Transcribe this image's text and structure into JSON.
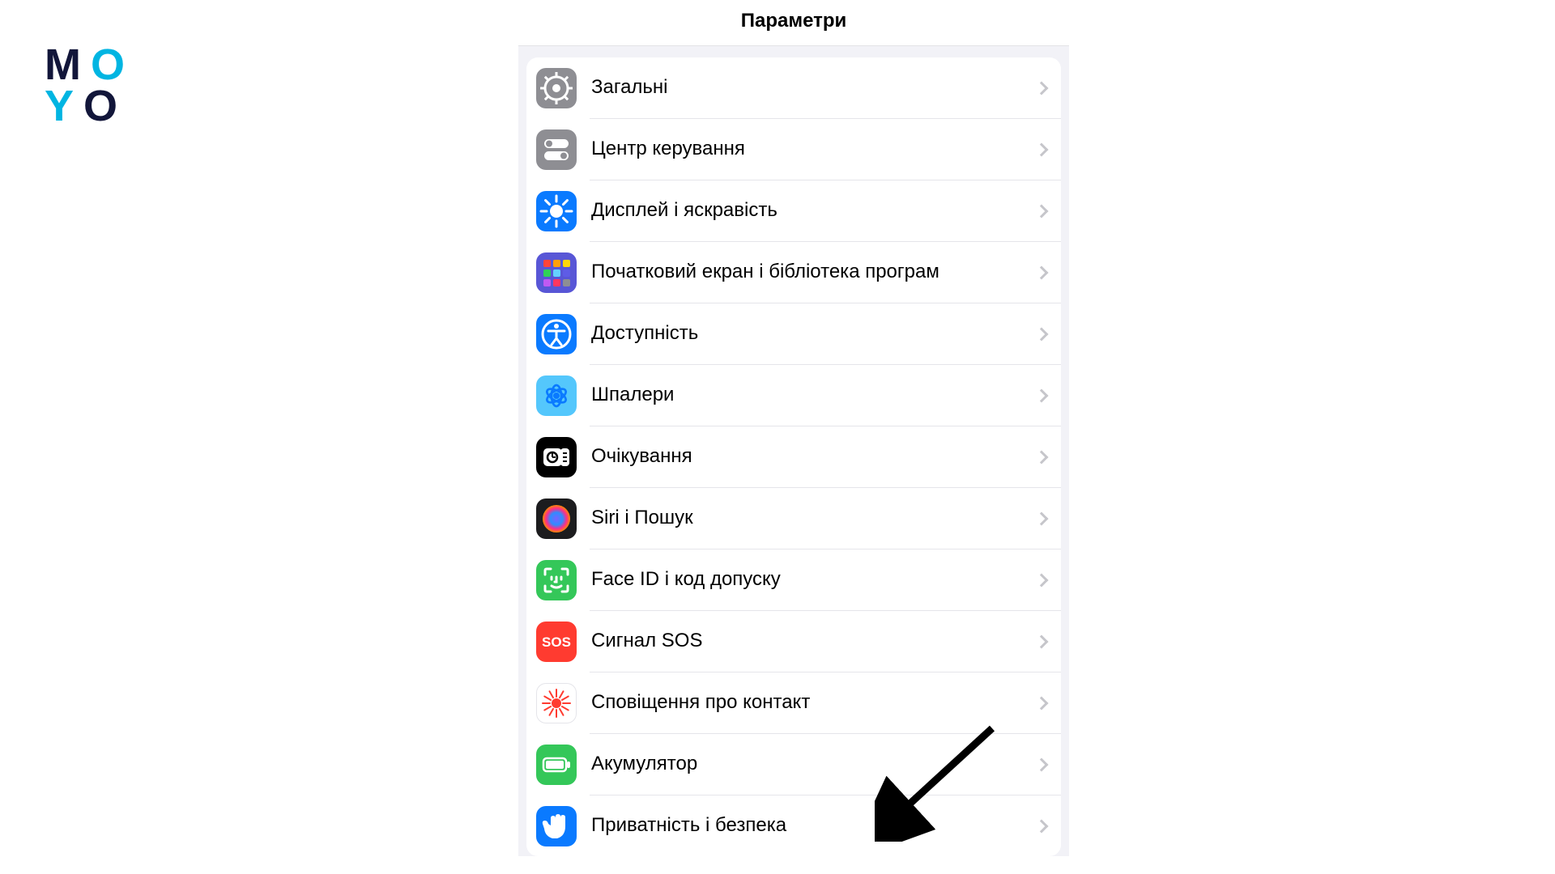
{
  "logo": {
    "l1a": "M",
    "l1b": "O",
    "l2a": "Y",
    "l2b": "O"
  },
  "header": {
    "title": "Параметри"
  },
  "items": [
    {
      "key": "general",
      "label": "Загальні",
      "bg": "#8e8e93",
      "icon": "gear"
    },
    {
      "key": "control",
      "label": "Центр керування",
      "bg": "#8e8e93",
      "icon": "toggles"
    },
    {
      "key": "display",
      "label": "Дисплей і яскравість",
      "bg": "#0a7aff",
      "icon": "sun"
    },
    {
      "key": "homescreen",
      "label": "Початковий екран і бібліотека програм",
      "bg": "#5856d6",
      "icon": "apps"
    },
    {
      "key": "accessibility",
      "label": "Доступність",
      "bg": "#0a7aff",
      "icon": "access"
    },
    {
      "key": "wallpaper",
      "label": "Шпалери",
      "bg": "#54c7fc",
      "icon": "flower"
    },
    {
      "key": "standby",
      "label": "Очікування",
      "bg": "#000000",
      "icon": "standby"
    },
    {
      "key": "siri",
      "label": "Siri і Пошук",
      "bg": "#1c1c1e",
      "icon": "siri"
    },
    {
      "key": "faceid",
      "label": "Face ID і код допуску",
      "bg": "#34c759",
      "icon": "faceid"
    },
    {
      "key": "sos",
      "label": "Сигнал SOS",
      "bg": "#ff3b30",
      "icon": "sos",
      "text": "SOS"
    },
    {
      "key": "exposure",
      "label": "Сповіщення про контакт",
      "bg": "#ffffff",
      "icon": "exposure",
      "border": true
    },
    {
      "key": "battery",
      "label": "Акумулятор",
      "bg": "#34c759",
      "icon": "battery"
    },
    {
      "key": "privacy",
      "label": "Приватність і безпека",
      "bg": "#0a7aff",
      "icon": "hand"
    }
  ]
}
